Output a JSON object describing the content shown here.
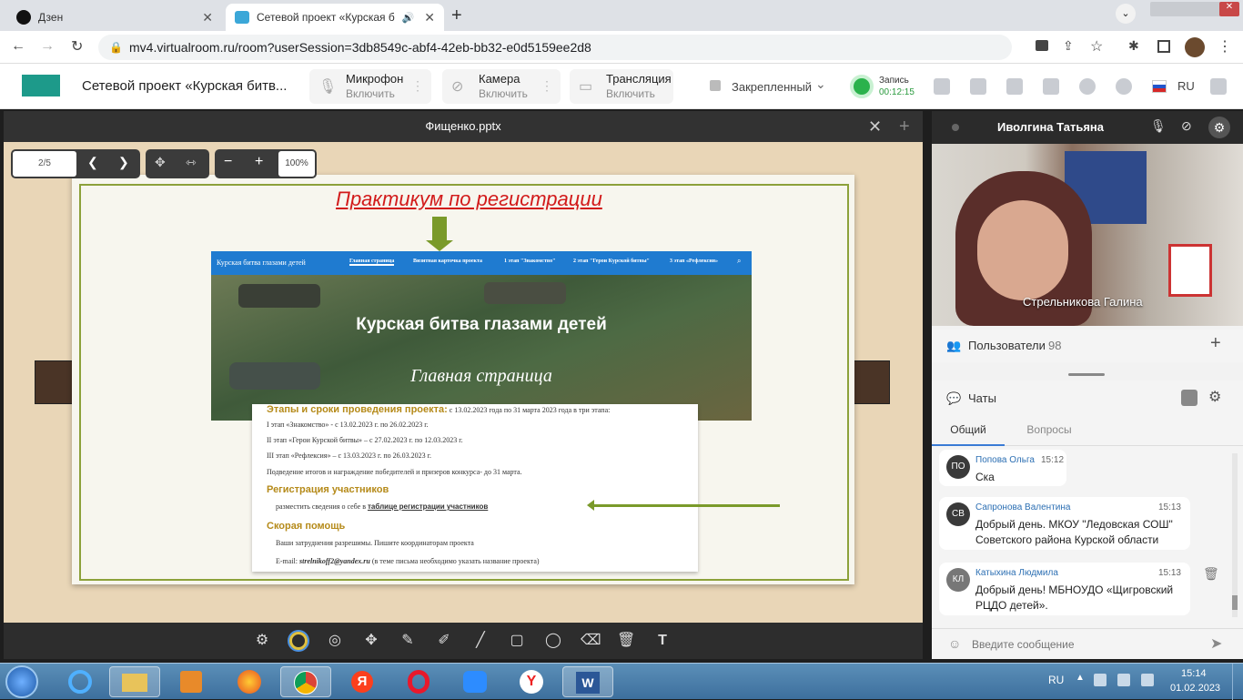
{
  "browser": {
    "tabs": [
      {
        "label": "Дзен"
      },
      {
        "label": "Сетевой проект «Курская б"
      }
    ],
    "url": "mv4.virtualroom.ru/room?userSession=3db8549c-abf4-42eb-bb32-e0d5159ee2d8"
  },
  "app": {
    "title": "Сетевой проект «Курская битв...",
    "mic": {
      "label": "Микрофон",
      "action": "Включить"
    },
    "camera": {
      "label": "Камера",
      "action": "Включить"
    },
    "broadcast": {
      "label": "Трансляция",
      "action": "Включить"
    },
    "pinned": "Закрепленный",
    "record": {
      "label": "Запись",
      "time": "00:12:15"
    },
    "lang": "RU"
  },
  "presentation": {
    "file": "Фищенко.pptx",
    "page": "2/5",
    "zoom": "100%",
    "slide": {
      "heading": "Практикум по регистрации",
      "site_brand": "Курская битва глазами детей",
      "nav": [
        "Главная страница",
        "Визитная карточка проекта",
        "1 этап \"Знакомство\"",
        "2 этап \"Герои Курской битвы\"",
        "3 этап «Рефлексия»"
      ],
      "banner_title": "Курская битва глазами детей",
      "banner_sub": "Главная страница",
      "stages_title": "Этапы и сроки проведения проекта:",
      "stages_intro": " с 13.02.2023 года по 31 марта 2023 года в три этапа:",
      "stage1": "I этап «Знакомство» - с 13.02.2023 г. по 26.02.2023 г.",
      "stage2": "II этап «Герои Курской битвы» – с 27.02.2023 г. по 12.03.2023 г.",
      "stage3": "III этап «Рефлексия» – с 13.03.2023 г. по 26.03.2023 г.",
      "results": "Подведение итогов и награждение победителей и призеров конкурса- до 31 марта.",
      "reg_title": "Регистрация участников",
      "reg_text": "разместить сведения о себе в ",
      "reg_link": "таблице регистрации участников",
      "help_title": "Скорая помощь",
      "help_text": "Ваши затруднения разрешимы. Пишите координаторам проекта",
      "email_prefix": "E-mail: ",
      "email": "strelnikoff2@yandex.ru",
      "email_note": " (в теме письма необходимо указать название проекта)"
    }
  },
  "video": {
    "owner": "Иволгина Татьяна",
    "speaker": "Стрельникова Галина"
  },
  "users": {
    "label": "Пользователи",
    "count": "98"
  },
  "chat": {
    "title": "Чаты",
    "tabs": [
      "Общий",
      "Вопросы"
    ],
    "messages": [
      {
        "initials": "ПО",
        "name": "Попова Ольга",
        "time": "15:12",
        "text": "Ска"
      },
      {
        "initials": "СВ",
        "name": "Сапронова Валентина",
        "time": "15:13",
        "text": "Добрый день. МКОУ \"Ледовская СОШ\" Советского района Курской области"
      },
      {
        "initials": "КЛ",
        "name": "Катыхина Людмила",
        "time": "15:13",
        "text": "Добрый день! МБНОУДО «Щигровский РЦДО детей»."
      }
    ],
    "placeholder": "Введите сообщение"
  },
  "taskbar": {
    "lang": "RU",
    "time": "15:14",
    "date": "01.02.2023"
  }
}
